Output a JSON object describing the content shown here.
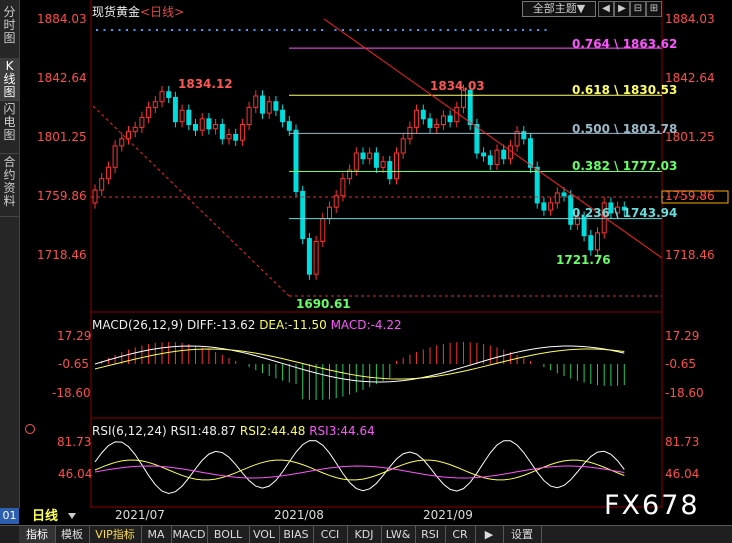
{
  "left_tabs": [
    {
      "label": "分时图",
      "active": false
    },
    {
      "label": "K线图",
      "active": true
    },
    {
      "label": "闪电图",
      "active": false
    },
    {
      "label": "合约资料",
      "active": false
    }
  ],
  "header": {
    "symbol": "现货黄金",
    "interval": "<日线>",
    "theme_label": "全部主题▼",
    "buttons": [
      "◀",
      "▶",
      "⊟",
      "⊞"
    ]
  },
  "price_axis": [
    "1884.03",
    "1842.64",
    "1801.25",
    "1759.86",
    "1718.46"
  ],
  "annotations": {
    "high_left": "1834.12",
    "high_right": "1834.03",
    "low": "1690.61",
    "low_right": "1721.76",
    "last_price_tag": "1759.86"
  },
  "fib_levels": [
    {
      "label": "0.764 \\ 1863.62",
      "color": "#ff55ff"
    },
    {
      "label": "0.618 \\ 1830.53",
      "color": "#ffff66"
    },
    {
      "label": "0.500 \\ 1803.78",
      "color": "#9ab8c8"
    },
    {
      "label": "0.382 \\ 1777.03",
      "color": "#66ff66"
    },
    {
      "label": "0.236 \\ 1743.94",
      "color": "#66dddd"
    }
  ],
  "macd": {
    "title": "MACD(26,12,9)",
    "diff": "DIFF:-13.62",
    "dea": "DEA:-11.50",
    "macd": "MACD:-4.22",
    "axis": [
      "17.29",
      "-0.65",
      "-18.60"
    ]
  },
  "rsi": {
    "title": "RSI(6,12,24)",
    "rsi1": "RSI1:48.87",
    "rsi2": "RSI2:44.48",
    "rsi3": "RSI3:44.64",
    "axis": [
      "81.73",
      "46.04"
    ]
  },
  "date_axis": [
    "2021/07",
    "2021/08",
    "2021/09"
  ],
  "period": {
    "left_stub": "01",
    "label": "日线"
  },
  "bottom_tabs": [
    "指标",
    "模板",
    "VIP指标",
    "MA",
    "MACD",
    "BOLL",
    "VOL",
    "BIAS",
    "CCI",
    "KDJ",
    "LW&",
    "RSI",
    "CR",
    "▶",
    "设置"
  ],
  "watermark": "FX678",
  "colors": {
    "up": "#ff3333",
    "down": "#00dddd",
    "ma": "#ffffff",
    "axis_text": "#ff4d4d",
    "trendline": "#ff2020"
  }
}
